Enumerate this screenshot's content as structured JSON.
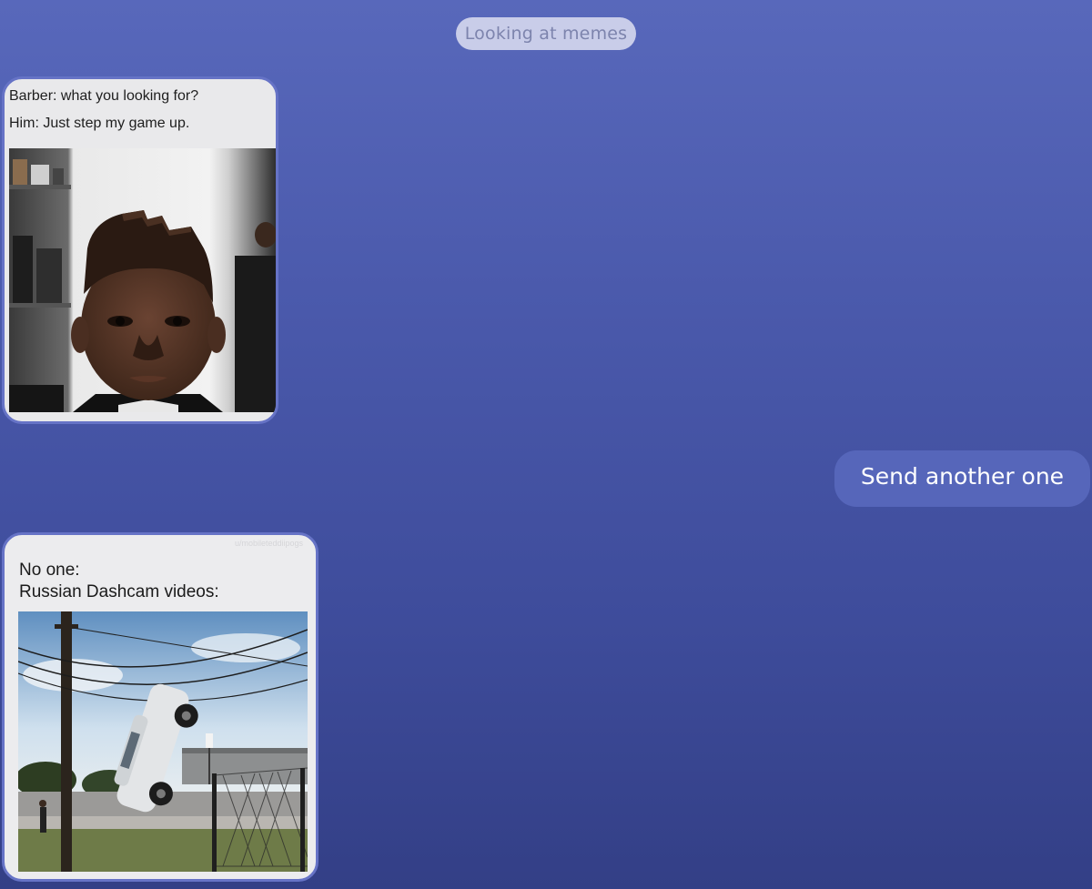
{
  "status": {
    "label": "Looking at memes"
  },
  "messages": [
    {
      "direction": "incoming",
      "type": "meme",
      "caption_lines": [
        "Barber: what you looking for?",
        "Him: Just step my game up."
      ]
    },
    {
      "direction": "outgoing",
      "type": "text",
      "text": "Send another one"
    },
    {
      "direction": "incoming",
      "type": "meme",
      "watermark": "u/mobileteddiipogs",
      "caption_lines": [
        "No one:",
        "Russian Dashcam videos:"
      ]
    }
  ],
  "colors": {
    "background_top": "#5868bb",
    "background_bottom": "#333f86",
    "outgoing_bubble": "#5666ba",
    "status_pill": "#c9cde9",
    "meme_border": "#6673c6"
  }
}
